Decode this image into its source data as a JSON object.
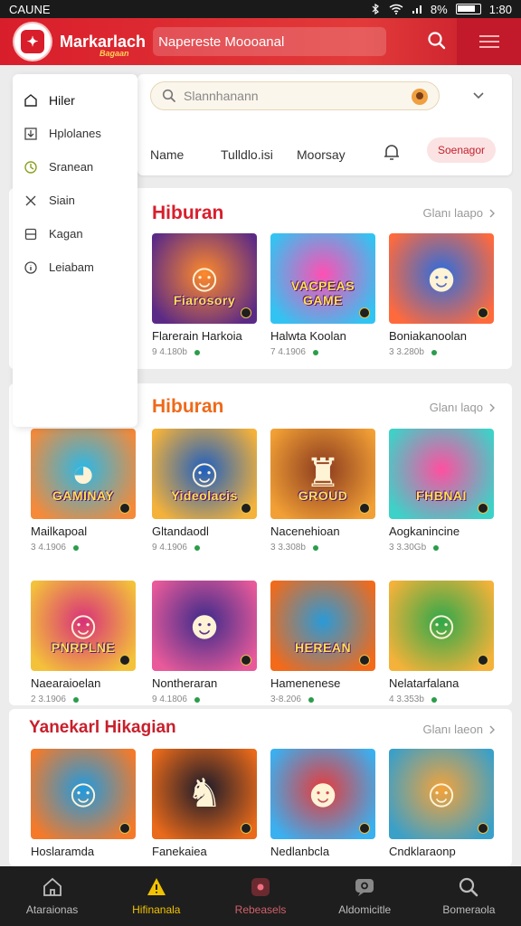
{
  "status_bar": {
    "carrier": "CAUNE",
    "battery": "8%",
    "time": "1:80"
  },
  "app_bar": {
    "brand": "Markarlach",
    "brand_tag": "Bagaan",
    "search_text": "Napereste Moooanal"
  },
  "search": {
    "placeholder": "Slannhanann"
  },
  "filters": {
    "tabs": [
      "Name",
      "Tulldlo.isi",
      "Moorsay"
    ],
    "button": "Soenagor"
  },
  "sidebar": {
    "items": [
      {
        "label": "Hiler",
        "icon": "home-icon"
      },
      {
        "label": "Hplolanes",
        "icon": "download-icon"
      },
      {
        "label": "Sranean",
        "icon": "clock-icon"
      },
      {
        "label": "Siain",
        "icon": "close-icon"
      },
      {
        "label": "Kagan",
        "icon": "bookmark-icon"
      },
      {
        "label": "Leiabam",
        "icon": "info-icon"
      }
    ]
  },
  "sections": [
    {
      "title": "Hiburan",
      "title_color": "#d81f2c",
      "more": "Glanı laapo",
      "games": [
        {
          "name": "Flarerain Harkoia",
          "meta": "9 4.180b",
          "thumb_text": "Fiarosory",
          "glyph": "☺",
          "c1": "#ff8a2b",
          "c2": "#5b2a86"
        },
        {
          "name": "Halwta Koolan",
          "meta": "7 4.1906",
          "thumb_text": "VACPEAS GAME",
          "glyph": "",
          "c1": "#ff4fb3",
          "c2": "#31c4f3"
        },
        {
          "name": "Boniakanoolan",
          "meta": "3 3.280b",
          "thumb_text": "",
          "glyph": "☻",
          "c1": "#2a6de0",
          "c2": "#ff6a3d"
        }
      ]
    },
    {
      "title": "Hiburan",
      "title_color": "#ee6a1a",
      "more": "Glanı laqo",
      "games": [
        {
          "name": "Mailkapoal",
          "meta": "3 4.1906",
          "thumb_text": "GAMINAY",
          "glyph": "◕",
          "c1": "#2ab8e8",
          "c2": "#f48a3a"
        },
        {
          "name": "Gltandaodl",
          "meta": "9 4.1906",
          "thumb_text": "Yideolacis",
          "glyph": "☺",
          "c1": "#1f5fbf",
          "c2": "#f4b23a"
        },
        {
          "name": "Nacenehioan",
          "meta": "3 3.308b",
          "thumb_text": "GROUD",
          "glyph": "♜",
          "c1": "#8a3a1f",
          "c2": "#f2a035"
        },
        {
          "name": "Aogkanincine",
          "meta": "3 3.30Gb",
          "thumb_text": "FHBNAI",
          "glyph": "",
          "c1": "#ff4fa0",
          "c2": "#3ed1c8"
        },
        {
          "name": "Naearaioelan",
          "meta": "2 3.1906",
          "thumb_text": "PNRPLNE",
          "glyph": "☺",
          "c1": "#d8307a",
          "c2": "#f4c23a"
        },
        {
          "name": "Nontheraran",
          "meta": "9 4.1806",
          "thumb_text": "",
          "glyph": "☻",
          "c1": "#3a2a8a",
          "c2": "#e85a9a"
        },
        {
          "name": "Hamenenese",
          "meta": "3-8.206",
          "thumb_text": "HEREAN",
          "glyph": "",
          "c1": "#2a9ad8",
          "c2": "#f26a1a"
        },
        {
          "name": "Nelatarfalana",
          "meta": "4 3.353b",
          "thumb_text": "",
          "glyph": "☺",
          "c1": "#2fa84a",
          "c2": "#f4b23a"
        }
      ]
    },
    {
      "title": "Yanekarl Hikagian",
      "title_color": "#c81f2c",
      "more": "Glanı laeon",
      "games": [
        {
          "name": "Hoslaramda",
          "meta": "",
          "thumb_text": "",
          "glyph": "☺",
          "c1": "#1f9ae0",
          "c2": "#f47a2a"
        },
        {
          "name": "Fanekaiea",
          "meta": "",
          "thumb_text": "",
          "glyph": "♞",
          "c1": "#1a1a2a",
          "c2": "#e86a1a"
        },
        {
          "name": "Nedlanbcla",
          "meta": "",
          "thumb_text": "",
          "glyph": "☻",
          "c1": "#e83a3a",
          "c2": "#3ab0f0"
        },
        {
          "name": "Cndklaraonp",
          "meta": "",
          "thumb_text": "",
          "glyph": "☺",
          "c1": "#f4a23a",
          "c2": "#3aa0c8"
        }
      ]
    }
  ],
  "bottom_nav": [
    {
      "label": "Ataraionas",
      "icon": "home-icon"
    },
    {
      "label": "Hifinanala",
      "icon": "warning-icon"
    },
    {
      "label": "Rebeasels",
      "icon": "record-icon"
    },
    {
      "label": "Aldomicitle",
      "icon": "chat-icon"
    },
    {
      "label": "Bomeraola",
      "icon": "search-icon"
    }
  ]
}
